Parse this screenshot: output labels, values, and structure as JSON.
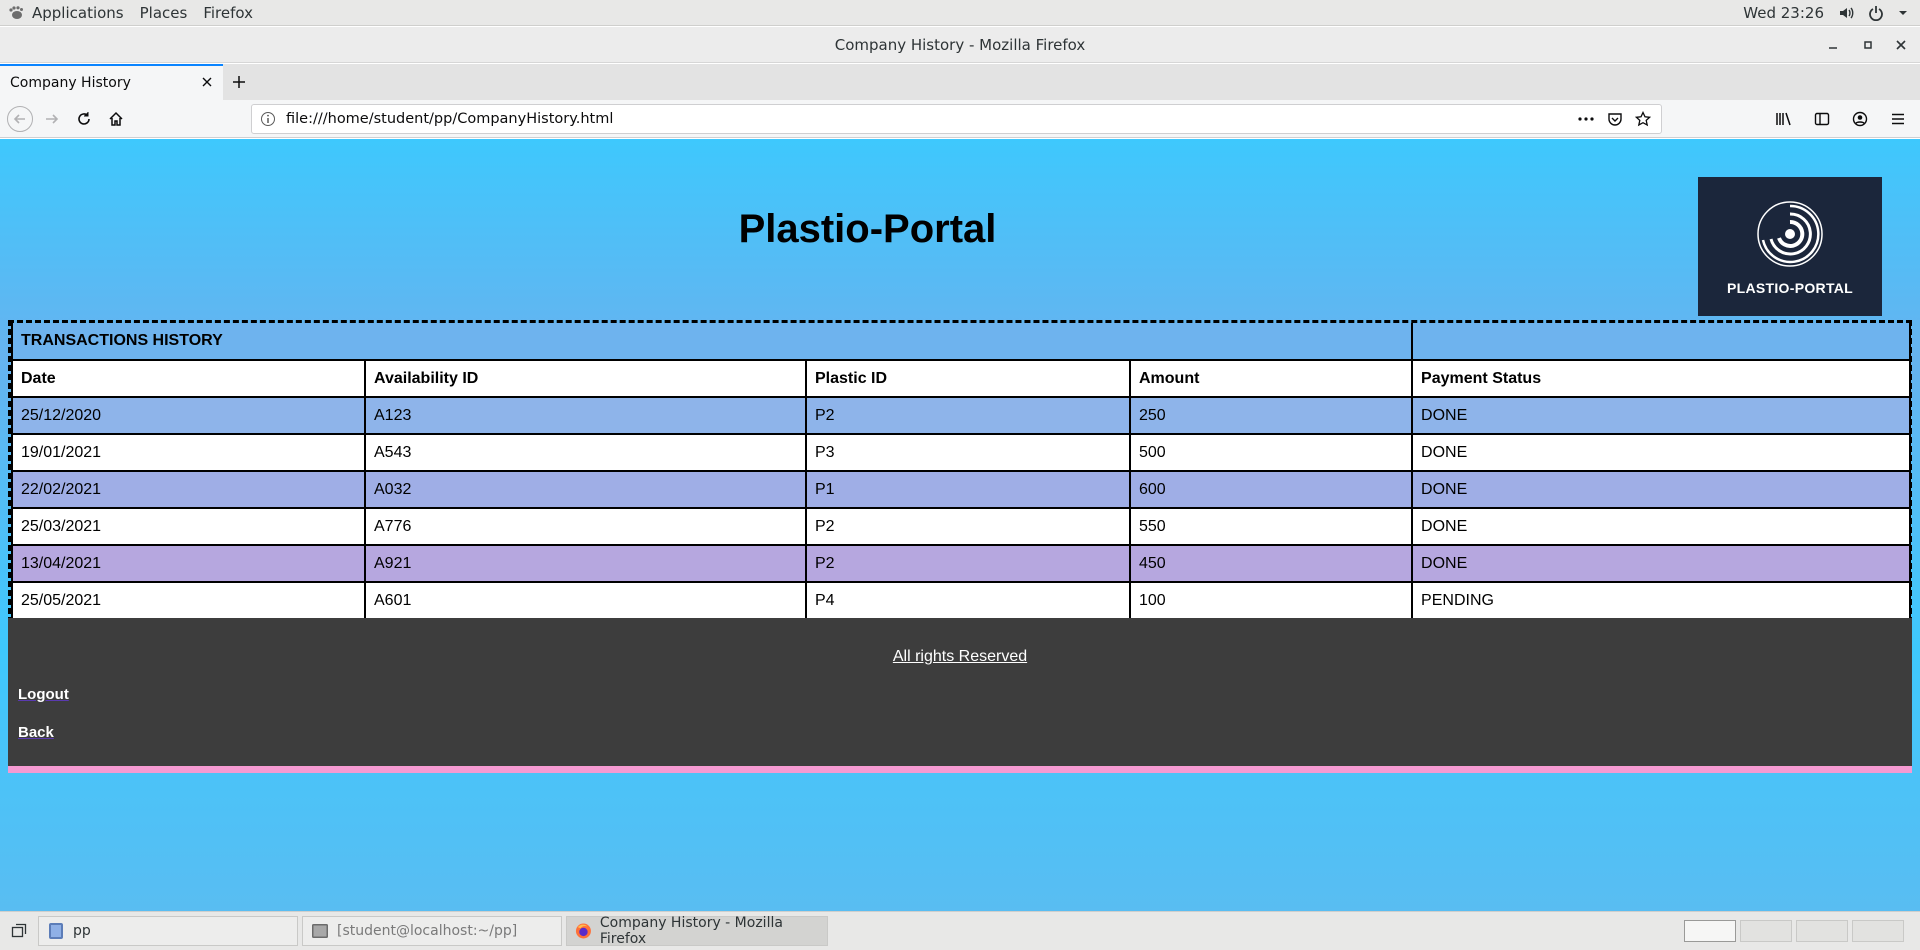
{
  "topbar": {
    "applications": "Applications",
    "places": "Places",
    "firefox": "Firefox",
    "clock": "Wed 23:26"
  },
  "window": {
    "title": "Company History - Mozilla Firefox"
  },
  "browser": {
    "tab_title": "Company History",
    "url": "file:///home/student/pp/CompanyHistory.html"
  },
  "page": {
    "title": "Plastio-Portal",
    "logo_text": "PLASTIO-PORTAL",
    "table": {
      "caption": "TRANSACTIONS HISTORY",
      "headers": [
        "Date",
        "Availability ID",
        "Plastic ID",
        "Amount",
        "Payment Status"
      ],
      "rows": [
        [
          "25/12/2020",
          "A123",
          "P2",
          "250",
          "DONE"
        ],
        [
          "19/01/2021",
          "A543",
          "P3",
          "500",
          "DONE"
        ],
        [
          "22/02/2021",
          "A032",
          "P1",
          "600",
          "DONE"
        ],
        [
          "25/03/2021",
          "A776",
          "P2",
          "550",
          "DONE"
        ],
        [
          "13/04/2021",
          "A921",
          "P2",
          "450",
          "DONE"
        ],
        [
          "25/05/2021",
          "A601",
          "P4",
          "100",
          "PENDING"
        ]
      ]
    },
    "footer": {
      "rights": "All rights Reserved",
      "logout": "Logout",
      "back": "Back"
    }
  },
  "taskbar": {
    "items": [
      "pp",
      "[student@localhost:~/pp]",
      "Company History - Mozilla Firefox"
    ]
  },
  "colors": {
    "accent": "#0a84ff",
    "page_bg": "#3ec8fd",
    "footer_bg": "#3d3d3d",
    "footer_border": "#f59ad2",
    "logo_bg": "#1b263b"
  }
}
